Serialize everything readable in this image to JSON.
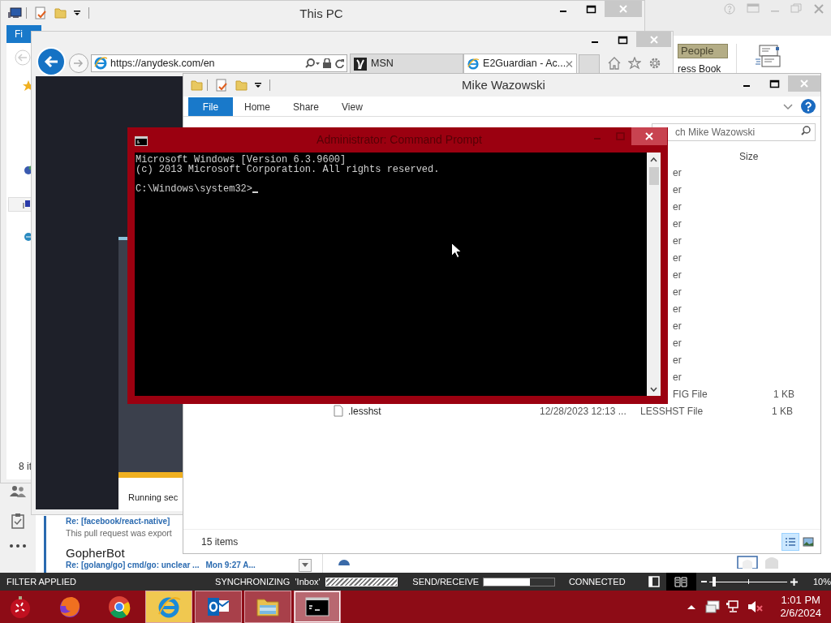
{
  "outlook": {
    "ribbon": {
      "people_button": "People",
      "address_book_button": "ress Book"
    },
    "messages": [
      {
        "subject": "Re: [facebook/react-native]",
        "preview": "This pull request was export"
      },
      {
        "sender": "GopherBot",
        "subject": "Re: [golang/go] cmd/go: unclear ...",
        "time": "Mon 9:27 A..."
      }
    ],
    "status_bar": {
      "filter": "FILTER APPLIED",
      "sync": "SYNCHRONIZING  'Inbox'",
      "sync_progress": {
        "level": 1
      },
      "send_receive": "SEND/RECEIVE",
      "send_receive_progress": {
        "level": 0.65
      },
      "connection": "CONNECTED",
      "view_buttons": [
        {
          "selected": false
        },
        {
          "selected": true
        }
      ],
      "zoom": {
        "level": 0.04
      },
      "zoom_reading": "10%"
    }
  },
  "this_pc": {
    "title": "This PC",
    "file_tab": "Fi",
    "status": "8 it"
  },
  "browser": {
    "url": "https://anydesk.com/en",
    "tabs": [
      {
        "label": "MSN",
        "selected": false
      },
      {
        "label": "E2Guardian - Ac...",
        "selected": true
      }
    ],
    "toast": "Running sec"
  },
  "explorer": {
    "title": "Mike Wazowski",
    "ribbon_tabs": [
      {
        "label": "File",
        "selected": true
      },
      {
        "label": "Home",
        "selected": false
      },
      {
        "label": "Share",
        "selected": false
      },
      {
        "label": "View",
        "selected": false
      }
    ],
    "search": {
      "placeholder": "ch Mike Wazowski"
    },
    "columns": [
      {
        "label": "Size"
      }
    ],
    "rows": [
      {
        "type": "er"
      },
      {
        "type": "er"
      },
      {
        "type": "er"
      },
      {
        "type": "er"
      },
      {
        "type": "er"
      },
      {
        "type": "er"
      },
      {
        "type": "er"
      },
      {
        "type": "er"
      },
      {
        "type": "er"
      },
      {
        "type": "er"
      },
      {
        "type": "er"
      },
      {
        "type": "er"
      },
      {
        "type": "er"
      },
      {
        "type": "FIG File",
        "size": "1 KB"
      },
      {
        "name": ".lesshst",
        "date": "12/28/2023 12:13 ...",
        "type": "LESSHST File",
        "size": "1 KB"
      }
    ],
    "item_count": "15 items",
    "view_buttons": [
      {
        "selected": true
      },
      {
        "selected": false
      }
    ]
  },
  "console": {
    "title": "Administrator: Command Prompt",
    "banner": [
      "Microsoft Windows [Version 6.3.9600]",
      "(c) 2013 Microsoft Corporation. All rights reserved."
    ],
    "prompt": "C:\\Windows\\system32>"
  },
  "taskbar": {
    "apps": [
      {
        "kind": "ornament",
        "running": false,
        "flashing": false,
        "selected": false
      },
      {
        "kind": "fox",
        "running": false,
        "flashing": false,
        "selected": false
      },
      {
        "kind": "ring",
        "running": false,
        "flashing": false,
        "selected": false
      },
      {
        "kind": "globe",
        "running": true,
        "flashing": true,
        "selected": false
      },
      {
        "kind": "mail",
        "running": true,
        "flashing": false,
        "selected": false
      },
      {
        "kind": "folder",
        "running": true,
        "flashing": false,
        "selected": false
      },
      {
        "kind": "terminal",
        "running": true,
        "flashing": false,
        "selected": true
      }
    ],
    "time": "1:01 PM",
    "date": "2/6/2024"
  }
}
